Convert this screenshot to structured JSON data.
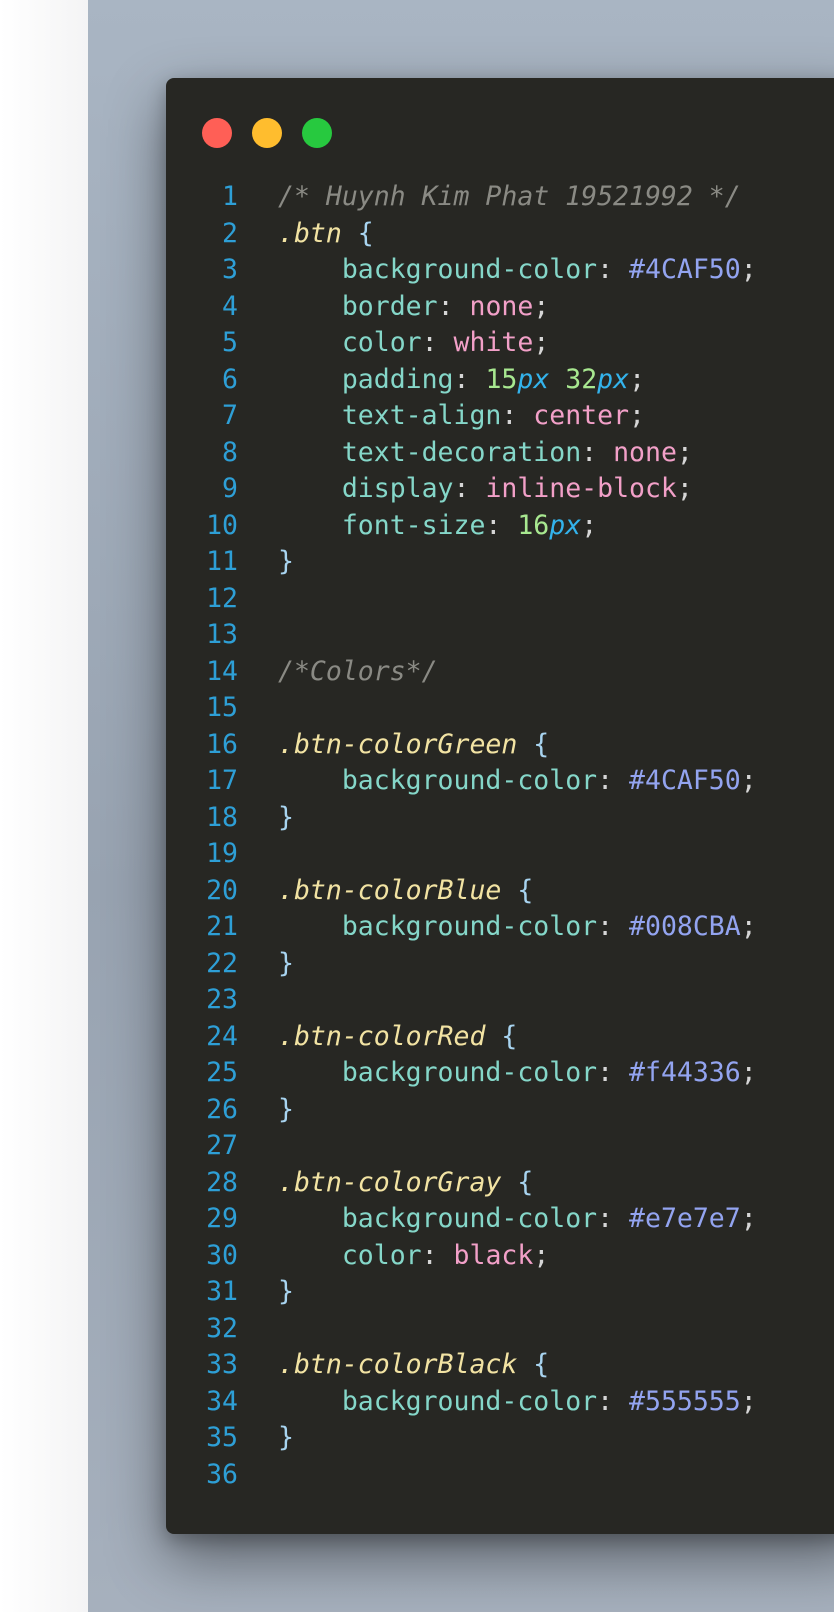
{
  "colors": {
    "window_bg": "#272723",
    "backdrop": "#a9b5c3",
    "line_number": "#2e9fd6",
    "comment": "#8a8a84",
    "selector": "#f2e3a3",
    "property": "#85d7c9",
    "keyword_value": "#f2a0c8",
    "hex_value": "#93a4f0",
    "number": "#a8e890",
    "unit": "#33b3ec"
  },
  "window": {
    "controls": [
      {
        "name": "close-button",
        "color": "#ff5f56"
      },
      {
        "name": "minimize-button",
        "color": "#ffbd2e"
      },
      {
        "name": "maximize-button",
        "color": "#27c93f"
      }
    ]
  },
  "code": {
    "language": "css",
    "lines": [
      {
        "n": "1",
        "tokens": [
          {
            "t": "comment",
            "v": "/* Huynh Kim Phat 19521992 */"
          }
        ]
      },
      {
        "n": "2",
        "tokens": [
          {
            "t": "selector",
            "v": ".btn"
          },
          {
            "t": "punct",
            "v": " "
          },
          {
            "t": "brace",
            "v": "{"
          }
        ]
      },
      {
        "n": "3",
        "tokens": [
          {
            "t": "punct",
            "v": "    "
          },
          {
            "t": "prop",
            "v": "background-color"
          },
          {
            "t": "punct",
            "v": ": "
          },
          {
            "t": "hex",
            "v": "#4CAF50"
          },
          {
            "t": "punct",
            "v": ";"
          }
        ]
      },
      {
        "n": "4",
        "tokens": [
          {
            "t": "punct",
            "v": "    "
          },
          {
            "t": "prop",
            "v": "border"
          },
          {
            "t": "punct",
            "v": ": "
          },
          {
            "t": "value",
            "v": "none"
          },
          {
            "t": "punct",
            "v": ";"
          }
        ]
      },
      {
        "n": "5",
        "tokens": [
          {
            "t": "punct",
            "v": "    "
          },
          {
            "t": "prop",
            "v": "color"
          },
          {
            "t": "punct",
            "v": ": "
          },
          {
            "t": "value",
            "v": "white"
          },
          {
            "t": "punct",
            "v": ";"
          }
        ]
      },
      {
        "n": "6",
        "tokens": [
          {
            "t": "punct",
            "v": "    "
          },
          {
            "t": "prop",
            "v": "padding"
          },
          {
            "t": "punct",
            "v": ": "
          },
          {
            "t": "num",
            "v": "15"
          },
          {
            "t": "unit",
            "v": "px"
          },
          {
            "t": "punct",
            "v": " "
          },
          {
            "t": "num",
            "v": "32"
          },
          {
            "t": "unit",
            "v": "px"
          },
          {
            "t": "punct",
            "v": ";"
          }
        ]
      },
      {
        "n": "7",
        "tokens": [
          {
            "t": "punct",
            "v": "    "
          },
          {
            "t": "prop",
            "v": "text-align"
          },
          {
            "t": "punct",
            "v": ": "
          },
          {
            "t": "value",
            "v": "center"
          },
          {
            "t": "punct",
            "v": ";"
          }
        ]
      },
      {
        "n": "8",
        "tokens": [
          {
            "t": "punct",
            "v": "    "
          },
          {
            "t": "prop",
            "v": "text-decoration"
          },
          {
            "t": "punct",
            "v": ": "
          },
          {
            "t": "value",
            "v": "none"
          },
          {
            "t": "punct",
            "v": ";"
          }
        ]
      },
      {
        "n": "9",
        "tokens": [
          {
            "t": "punct",
            "v": "    "
          },
          {
            "t": "prop",
            "v": "display"
          },
          {
            "t": "punct",
            "v": ": "
          },
          {
            "t": "value",
            "v": "inline-block"
          },
          {
            "t": "punct",
            "v": ";"
          }
        ]
      },
      {
        "n": "10",
        "tokens": [
          {
            "t": "punct",
            "v": "    "
          },
          {
            "t": "prop",
            "v": "font-size"
          },
          {
            "t": "punct",
            "v": ": "
          },
          {
            "t": "num",
            "v": "16"
          },
          {
            "t": "unit",
            "v": "px"
          },
          {
            "t": "punct",
            "v": ";"
          }
        ]
      },
      {
        "n": "11",
        "tokens": [
          {
            "t": "brace",
            "v": "}"
          }
        ]
      },
      {
        "n": "12",
        "tokens": []
      },
      {
        "n": "13",
        "tokens": []
      },
      {
        "n": "14",
        "tokens": [
          {
            "t": "comment",
            "v": "/*Colors*/"
          }
        ]
      },
      {
        "n": "15",
        "tokens": []
      },
      {
        "n": "16",
        "tokens": [
          {
            "t": "selector",
            "v": ".btn-colorGreen"
          },
          {
            "t": "punct",
            "v": " "
          },
          {
            "t": "brace",
            "v": "{"
          }
        ]
      },
      {
        "n": "17",
        "tokens": [
          {
            "t": "punct",
            "v": "    "
          },
          {
            "t": "prop",
            "v": "background-color"
          },
          {
            "t": "punct",
            "v": ": "
          },
          {
            "t": "hex",
            "v": "#4CAF50"
          },
          {
            "t": "punct",
            "v": ";"
          }
        ]
      },
      {
        "n": "18",
        "tokens": [
          {
            "t": "brace",
            "v": "}"
          }
        ]
      },
      {
        "n": "19",
        "tokens": []
      },
      {
        "n": "20",
        "tokens": [
          {
            "t": "selector",
            "v": ".btn-colorBlue"
          },
          {
            "t": "punct",
            "v": " "
          },
          {
            "t": "brace",
            "v": "{"
          }
        ]
      },
      {
        "n": "21",
        "tokens": [
          {
            "t": "punct",
            "v": "    "
          },
          {
            "t": "prop",
            "v": "background-color"
          },
          {
            "t": "punct",
            "v": ": "
          },
          {
            "t": "hex",
            "v": "#008CBA"
          },
          {
            "t": "punct",
            "v": ";"
          }
        ]
      },
      {
        "n": "22",
        "tokens": [
          {
            "t": "brace",
            "v": "}"
          }
        ]
      },
      {
        "n": "23",
        "tokens": []
      },
      {
        "n": "24",
        "tokens": [
          {
            "t": "selector",
            "v": ".btn-colorRed"
          },
          {
            "t": "punct",
            "v": " "
          },
          {
            "t": "brace",
            "v": "{"
          }
        ]
      },
      {
        "n": "25",
        "tokens": [
          {
            "t": "punct",
            "v": "    "
          },
          {
            "t": "prop",
            "v": "background-color"
          },
          {
            "t": "punct",
            "v": ": "
          },
          {
            "t": "hex",
            "v": "#f44336"
          },
          {
            "t": "punct",
            "v": ";"
          }
        ]
      },
      {
        "n": "26",
        "tokens": [
          {
            "t": "brace",
            "v": "}"
          }
        ]
      },
      {
        "n": "27",
        "tokens": []
      },
      {
        "n": "28",
        "tokens": [
          {
            "t": "selector",
            "v": ".btn-colorGray"
          },
          {
            "t": "punct",
            "v": " "
          },
          {
            "t": "brace",
            "v": "{"
          }
        ]
      },
      {
        "n": "29",
        "tokens": [
          {
            "t": "punct",
            "v": "    "
          },
          {
            "t": "prop",
            "v": "background-color"
          },
          {
            "t": "punct",
            "v": ": "
          },
          {
            "t": "hex",
            "v": "#e7e7e7"
          },
          {
            "t": "punct",
            "v": ";"
          }
        ]
      },
      {
        "n": "30",
        "tokens": [
          {
            "t": "punct",
            "v": "    "
          },
          {
            "t": "prop",
            "v": "color"
          },
          {
            "t": "punct",
            "v": ": "
          },
          {
            "t": "value",
            "v": "black"
          },
          {
            "t": "punct",
            "v": ";"
          }
        ]
      },
      {
        "n": "31",
        "tokens": [
          {
            "t": "brace",
            "v": "}"
          }
        ]
      },
      {
        "n": "32",
        "tokens": []
      },
      {
        "n": "33",
        "tokens": [
          {
            "t": "selector",
            "v": ".btn-colorBlack"
          },
          {
            "t": "punct",
            "v": " "
          },
          {
            "t": "brace",
            "v": "{"
          }
        ]
      },
      {
        "n": "34",
        "tokens": [
          {
            "t": "punct",
            "v": "    "
          },
          {
            "t": "prop",
            "v": "background-color"
          },
          {
            "t": "punct",
            "v": ": "
          },
          {
            "t": "hex",
            "v": "#555555"
          },
          {
            "t": "punct",
            "v": ";"
          }
        ]
      },
      {
        "n": "35",
        "tokens": [
          {
            "t": "brace",
            "v": "}"
          }
        ]
      },
      {
        "n": "36",
        "tokens": []
      }
    ]
  }
}
